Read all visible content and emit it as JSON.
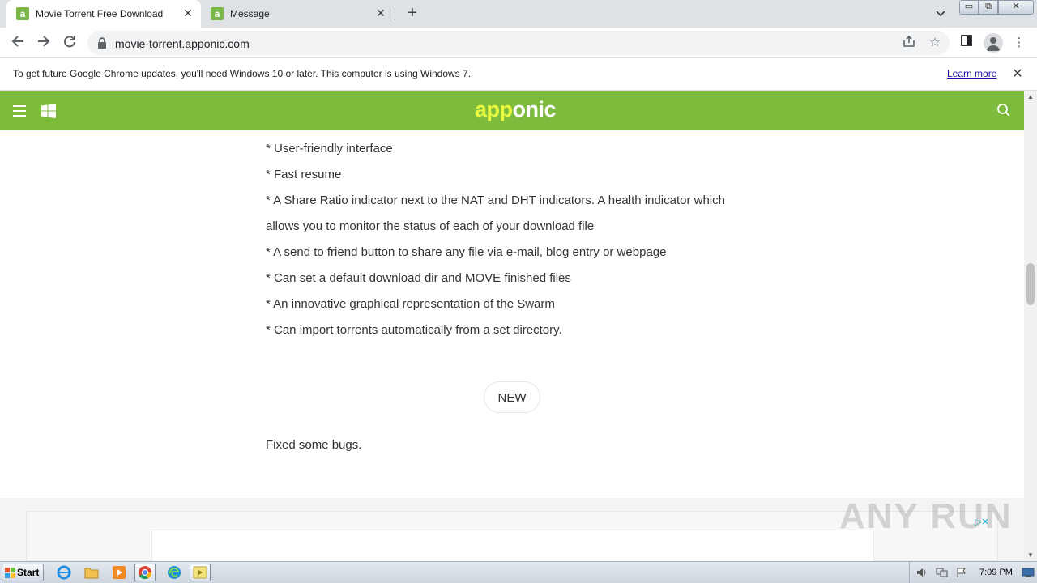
{
  "browser": {
    "tabs": [
      {
        "title": "Movie Torrent Free Download",
        "favicon": "a",
        "active": true
      },
      {
        "title": "Message",
        "favicon": "a",
        "active": false
      }
    ],
    "url": "movie-torrent.apponic.com"
  },
  "infobar": {
    "text": "To get future Google Chrome updates, you'll need Windows 10 or later. This computer is using Windows 7.",
    "link": "Learn more"
  },
  "site": {
    "logo_part1": "app",
    "logo_part2": "onic",
    "brand_color": "#7cbb3c"
  },
  "content": {
    "features": [
      "* User-friendly interface",
      "* Fast resume",
      "* A Share Ratio indicator next to the NAT and DHT indicators. A health indicator which",
      "allows you to monitor the status of each of your download file",
      "* A send to friend button to share any file via e-mail, blog entry or webpage",
      "* Can set a default download dir and MOVE finished files",
      "* An innovative graphical representation of the Swarm",
      "* Can import torrents automatically from a set directory."
    ],
    "badge": "NEW",
    "changes": "Fixed some bugs."
  },
  "watermark": "ANY RUN",
  "taskbar": {
    "start": "Start",
    "time": "7:09 PM"
  }
}
